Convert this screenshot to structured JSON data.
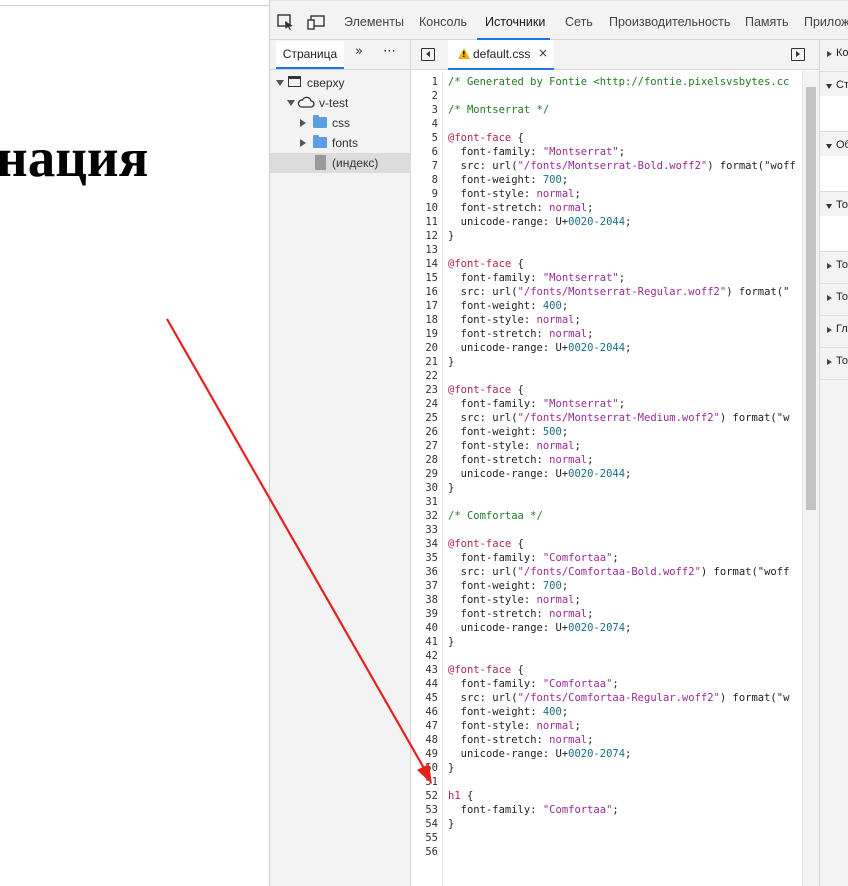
{
  "page": {
    "heading": "нация"
  },
  "devtools": {
    "tabs": [
      {
        "label": "Элементы"
      },
      {
        "label": "Консоль"
      },
      {
        "label": "Источники"
      },
      {
        "label": "Сеть"
      },
      {
        "label": "Производительность"
      },
      {
        "label": "Память"
      },
      {
        "label": "Прилож"
      }
    ],
    "active_tab": "Источники",
    "icons": [
      "inspect-element-icon",
      "device-toggle-icon"
    ]
  },
  "navigator": {
    "page_tab": "Страница",
    "more_tabs": "»",
    "menu": "⋯",
    "tree": [
      {
        "label": "сверху",
        "icon": "window-icon",
        "expanded": true
      },
      {
        "label": "v-test",
        "icon": "cloud-icon",
        "expanded": true
      },
      {
        "label": "css",
        "icon": "folder-icon",
        "expanded": false
      },
      {
        "label": "fonts",
        "icon": "folder-icon",
        "expanded": false
      },
      {
        "label": "(индекс)",
        "icon": "file-icon",
        "selected": true
      }
    ]
  },
  "editor": {
    "file_tab": "default.css",
    "close": "×",
    "lines": [
      "/* Generated by Fontie <http://fontie.pixelsvsbytes.cc",
      "",
      "/* Montserrat */",
      "",
      "@font-face {",
      "  font-family: \"Montserrat\";",
      "  src: url(\"/fonts/Montserrat-Bold.woff2\") format(\"woff",
      "  font-weight: 700;",
      "  font-style: normal;",
      "  font-stretch: normal;",
      "  unicode-range: U+0020-2044;",
      "}",
      "",
      "@font-face {",
      "  font-family: \"Montserrat\";",
      "  src: url(\"/fonts/Montserrat-Regular.woff2\") format(\"",
      "  font-weight: 400;",
      "  font-style: normal;",
      "  font-stretch: normal;",
      "  unicode-range: U+0020-2044;",
      "}",
      "",
      "@font-face {",
      "  font-family: \"Montserrat\";",
      "  src: url(\"/fonts/Montserrat-Medium.woff2\") format(\"w",
      "  font-weight: 500;",
      "  font-style: normal;",
      "  font-stretch: normal;",
      "  unicode-range: U+0020-2044;",
      "}",
      "",
      "/* Comfortaa */",
      "",
      "@font-face {",
      "  font-family: \"Comfortaa\";",
      "  src: url(\"/fonts/Comfortaa-Bold.woff2\") format(\"woff",
      "  font-weight: 700;",
      "  font-style: normal;",
      "  font-stretch: normal;",
      "  unicode-range: U+0020-2074;",
      "}",
      "",
      "@font-face {",
      "  font-family: \"Comfortaa\";",
      "  src: url(\"/fonts/Comfortaa-Regular.woff2\") format(\"w",
      "  font-weight: 400;",
      "  font-style: normal;",
      "  font-stretch: normal;",
      "  unicode-range: U+0020-2074;",
      "}",
      "",
      "h1 {",
      "  font-family: \"Comfortaa\";",
      "}",
      "",
      ""
    ]
  },
  "sidebar": {
    "sections": [
      {
        "label": "Ко",
        "open": false
      },
      {
        "label": "Ст",
        "open": true
      },
      {
        "label": "Об",
        "open": true
      },
      {
        "label": "То",
        "open": true
      },
      {
        "label": "То",
        "open": false
      },
      {
        "label": "То",
        "open": false
      },
      {
        "label": "Гл",
        "open": false
      },
      {
        "label": "То",
        "open": false
      }
    ],
    "pause_icon": "pause-icon"
  },
  "colors": {
    "accent": "#1a73e8",
    "annotation_arrow": "#e8201a",
    "comment": "#237a23",
    "at_rule": "#b3264a",
    "string": "#9a2b96",
    "number": "#1b6e8a"
  }
}
